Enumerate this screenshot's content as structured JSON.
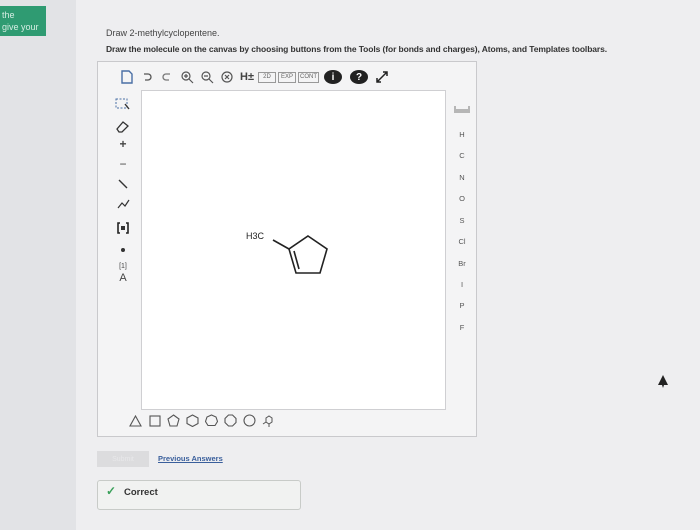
{
  "sidebar": {
    "hint_line1": "the",
    "hint_line2": "give your"
  },
  "question": {
    "prompt": "Draw 2-methylcyclopentene.",
    "instructions": "Draw the molecule on the canvas by choosing buttons from the Tools (for bonds and charges), Atoms, and Templates toolbars."
  },
  "toolbar": {
    "hydrogen_label": "H±",
    "two_d_label": "2D",
    "exp_label": "EXP",
    "cont_label": "CONT",
    "info_label": "i",
    "help_label": "?"
  },
  "tools": {
    "charge_plus": "+",
    "charge_minus": "−",
    "bracket_label": "[1]",
    "atom_label": "A"
  },
  "atoms": [
    "H",
    "C",
    "N",
    "O",
    "S",
    "Cl",
    "Br",
    "I",
    "P",
    "F"
  ],
  "molecule": {
    "substituent_label": "H3C"
  },
  "actions": {
    "submit_label": "Submit",
    "previous_answers_label": "Previous Answers"
  },
  "feedback": {
    "status": "Correct",
    "status_color": "#3aa05a"
  }
}
